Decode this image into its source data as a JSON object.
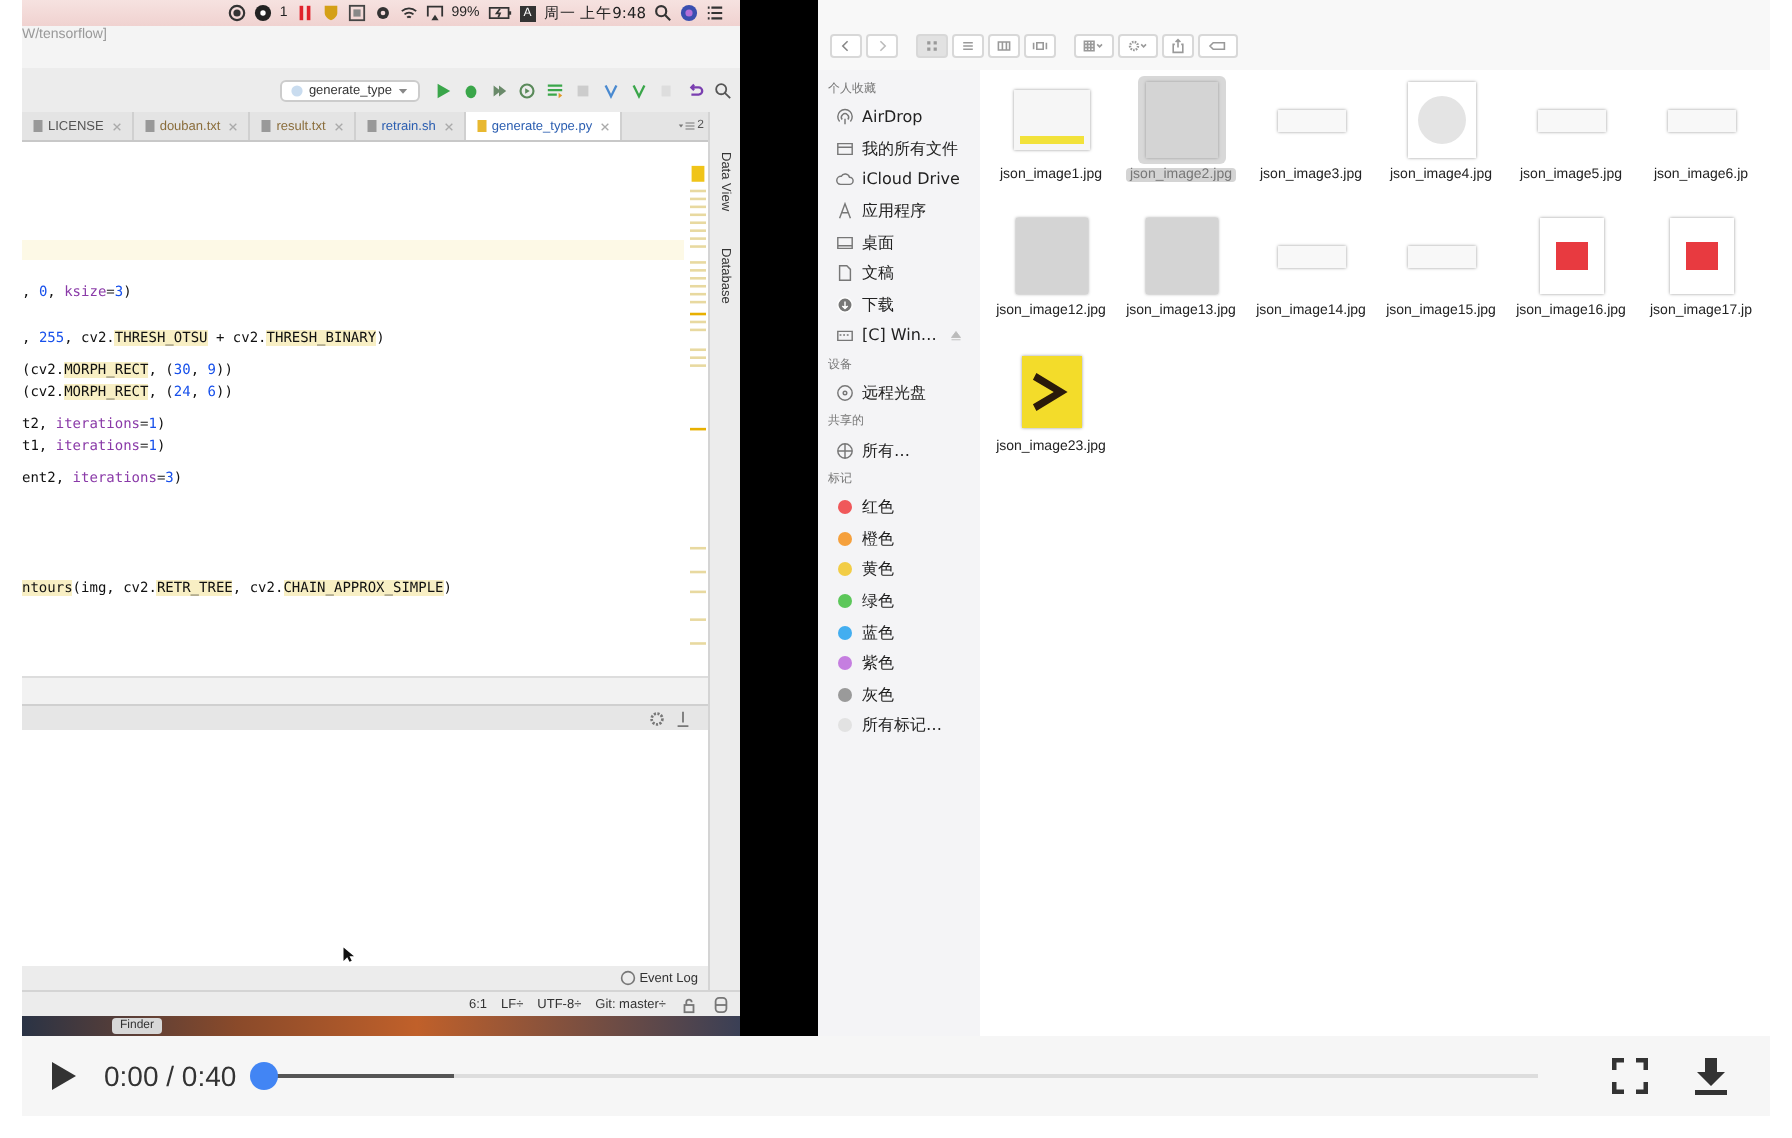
{
  "menubar": {
    "badge_count": "1",
    "battery": "99%",
    "input_source": "A",
    "clock": "周一 上午9:48"
  },
  "ide": {
    "title_path": "W/tensorflow]",
    "run_config": "generate_type",
    "tabs": [
      {
        "label": "LICENSE",
        "selected": false,
        "color": "#555555"
      },
      {
        "label": "douban.txt",
        "selected": false,
        "color": "#8a6d3b"
      },
      {
        "label": "result.txt",
        "selected": false,
        "color": "#8a6d3b"
      },
      {
        "label": "retrain.sh",
        "selected": false,
        "color": "#2a5db0"
      },
      {
        "label": "generate_type.py",
        "selected": true,
        "color": "#2a5db0"
      }
    ],
    "tab_overflow": "2",
    "side_tools": [
      "Data View",
      "Database"
    ],
    "code_lines": [
      {
        "segments": [
          {
            "text": ", ",
            "kind": "plain"
          },
          {
            "text": "0",
            "kind": "num"
          },
          {
            "text": ", ",
            "kind": "plain"
          },
          {
            "text": "ksize",
            "kind": "kw"
          },
          {
            "text": "=",
            "kind": "plain"
          },
          {
            "text": "3",
            "kind": "num"
          },
          {
            "text": ")",
            "kind": "plain"
          }
        ]
      },
      {
        "segments": [
          {
            "text": ", ",
            "kind": "plain"
          },
          {
            "text": "255",
            "kind": "num"
          },
          {
            "text": ", cv2.",
            "kind": "plain"
          },
          {
            "text": "THRESH_OTSU",
            "kind": "hl"
          },
          {
            "text": " + cv2.",
            "kind": "plain"
          },
          {
            "text": "THRESH_BINARY",
            "kind": "hl"
          },
          {
            "text": ")",
            "kind": "plain"
          }
        ]
      },
      {
        "segments": [
          {
            "text": "(cv2.",
            "kind": "plain"
          },
          {
            "text": "MORPH_RECT",
            "kind": "hl"
          },
          {
            "text": ", (",
            "kind": "plain"
          },
          {
            "text": "30",
            "kind": "num"
          },
          {
            "text": ", ",
            "kind": "plain"
          },
          {
            "text": "9",
            "kind": "num"
          },
          {
            "text": "))",
            "kind": "plain"
          }
        ]
      },
      {
        "segments": [
          {
            "text": "(cv2.",
            "kind": "plain"
          },
          {
            "text": "MORPH_RECT",
            "kind": "hl"
          },
          {
            "text": ", (",
            "kind": "plain"
          },
          {
            "text": "24",
            "kind": "num"
          },
          {
            "text": ", ",
            "kind": "plain"
          },
          {
            "text": "6",
            "kind": "num"
          },
          {
            "text": "))",
            "kind": "plain"
          }
        ]
      },
      {
        "segments": [
          {
            "text": "t2, ",
            "kind": "plain"
          },
          {
            "text": "iterations",
            "kind": "kw"
          },
          {
            "text": "=",
            "kind": "plain"
          },
          {
            "text": "1",
            "kind": "num"
          },
          {
            "text": ")",
            "kind": "plain"
          }
        ]
      },
      {
        "segments": [
          {
            "text": "t1, ",
            "kind": "plain"
          },
          {
            "text": "iterations",
            "kind": "kw"
          },
          {
            "text": "=",
            "kind": "plain"
          },
          {
            "text": "1",
            "kind": "num"
          },
          {
            "text": ")",
            "kind": "plain"
          }
        ]
      },
      {
        "segments": [
          {
            "text": "ent2, ",
            "kind": "plain"
          },
          {
            "text": "iterations",
            "kind": "kw"
          },
          {
            "text": "=",
            "kind": "plain"
          },
          {
            "text": "3",
            "kind": "num"
          },
          {
            "text": ")",
            "kind": "plain"
          }
        ]
      },
      {
        "segments": [
          {
            "text": "ntours",
            "kind": "hl"
          },
          {
            "text": "(img, cv2.",
            "kind": "plain"
          },
          {
            "text": "RETR_TREE",
            "kind": "hl"
          },
          {
            "text": ", cv2.",
            "kind": "plain"
          },
          {
            "text": "CHAIN_APPROX_SIMPLE",
            "kind": "hl"
          },
          {
            "text": ")",
            "kind": "plain"
          }
        ]
      }
    ],
    "event_log": "Event Log",
    "status": [
      "6:1",
      "LF÷",
      "UTF-8÷",
      "Git: master÷"
    ],
    "dock_label": "Finder"
  },
  "finder": {
    "sidebar": [
      {
        "heading": "个人收藏",
        "items": [
          {
            "label": "AirDrop",
            "kind": "airdrop"
          },
          {
            "label": "我的所有文件",
            "kind": "files"
          },
          {
            "label": "iCloud Drive",
            "kind": "cloud"
          },
          {
            "label": "应用程序",
            "kind": "apps"
          },
          {
            "label": "桌面",
            "kind": "desktop"
          },
          {
            "label": "文稿",
            "kind": "docs"
          },
          {
            "label": "下载",
            "kind": "download"
          },
          {
            "label": "[C] Win…",
            "kind": "disk"
          }
        ]
      },
      {
        "heading": "设备",
        "items": [
          {
            "label": "远程光盘",
            "kind": "disc"
          }
        ]
      },
      {
        "heading": "共享的",
        "items": [
          {
            "label": "所有…",
            "kind": "network"
          }
        ]
      },
      {
        "heading": "标记",
        "items": [
          {
            "label": "红色",
            "kind": "tag",
            "color": "#f0585a"
          },
          {
            "label": "橙色",
            "kind": "tag",
            "color": "#f5a03c"
          },
          {
            "label": "黄色",
            "kind": "tag",
            "color": "#f2cd46"
          },
          {
            "label": "绿色",
            "kind": "tag",
            "color": "#5cc75a"
          },
          {
            "label": "蓝色",
            "kind": "tag",
            "color": "#43aef0"
          },
          {
            "label": "紫色",
            "kind": "tag",
            "color": "#c57ee0"
          },
          {
            "label": "灰色",
            "kind": "tag",
            "color": "#9a9a9a"
          },
          {
            "label": "所有标记…",
            "kind": "tag",
            "color": "#e2e2e2"
          }
        ]
      }
    ],
    "files": [
      {
        "name": "json_image1.jpg",
        "selected": false,
        "kind": "doc"
      },
      {
        "name": "json_image2.jpg",
        "selected": true,
        "kind": "blank"
      },
      {
        "name": "json_image3.jpg",
        "selected": false,
        "kind": "text"
      },
      {
        "name": "json_image4.jpg",
        "selected": false,
        "kind": "disc"
      },
      {
        "name": "json_image5.jpg",
        "selected": false,
        "kind": "text"
      },
      {
        "name": "json_image6.jp",
        "selected": false,
        "kind": "text"
      },
      {
        "name": "json_image12.jpg",
        "selected": false,
        "kind": "blank"
      },
      {
        "name": "json_image13.jpg",
        "selected": false,
        "kind": "blank"
      },
      {
        "name": "json_image14.jpg",
        "selected": false,
        "kind": "text"
      },
      {
        "name": "json_image15.jpg",
        "selected": false,
        "kind": "text"
      },
      {
        "name": "json_image16.jpg",
        "selected": false,
        "kind": "red"
      },
      {
        "name": "json_image17.jp",
        "selected": false,
        "kind": "red"
      },
      {
        "name": "json_image23.jpg",
        "selected": false,
        "kind": "arrow"
      }
    ]
  },
  "player": {
    "time": "0:00 / 0:40",
    "progress": {
      "level": 0,
      "buffered": {
        "level": 0.15
      }
    }
  }
}
